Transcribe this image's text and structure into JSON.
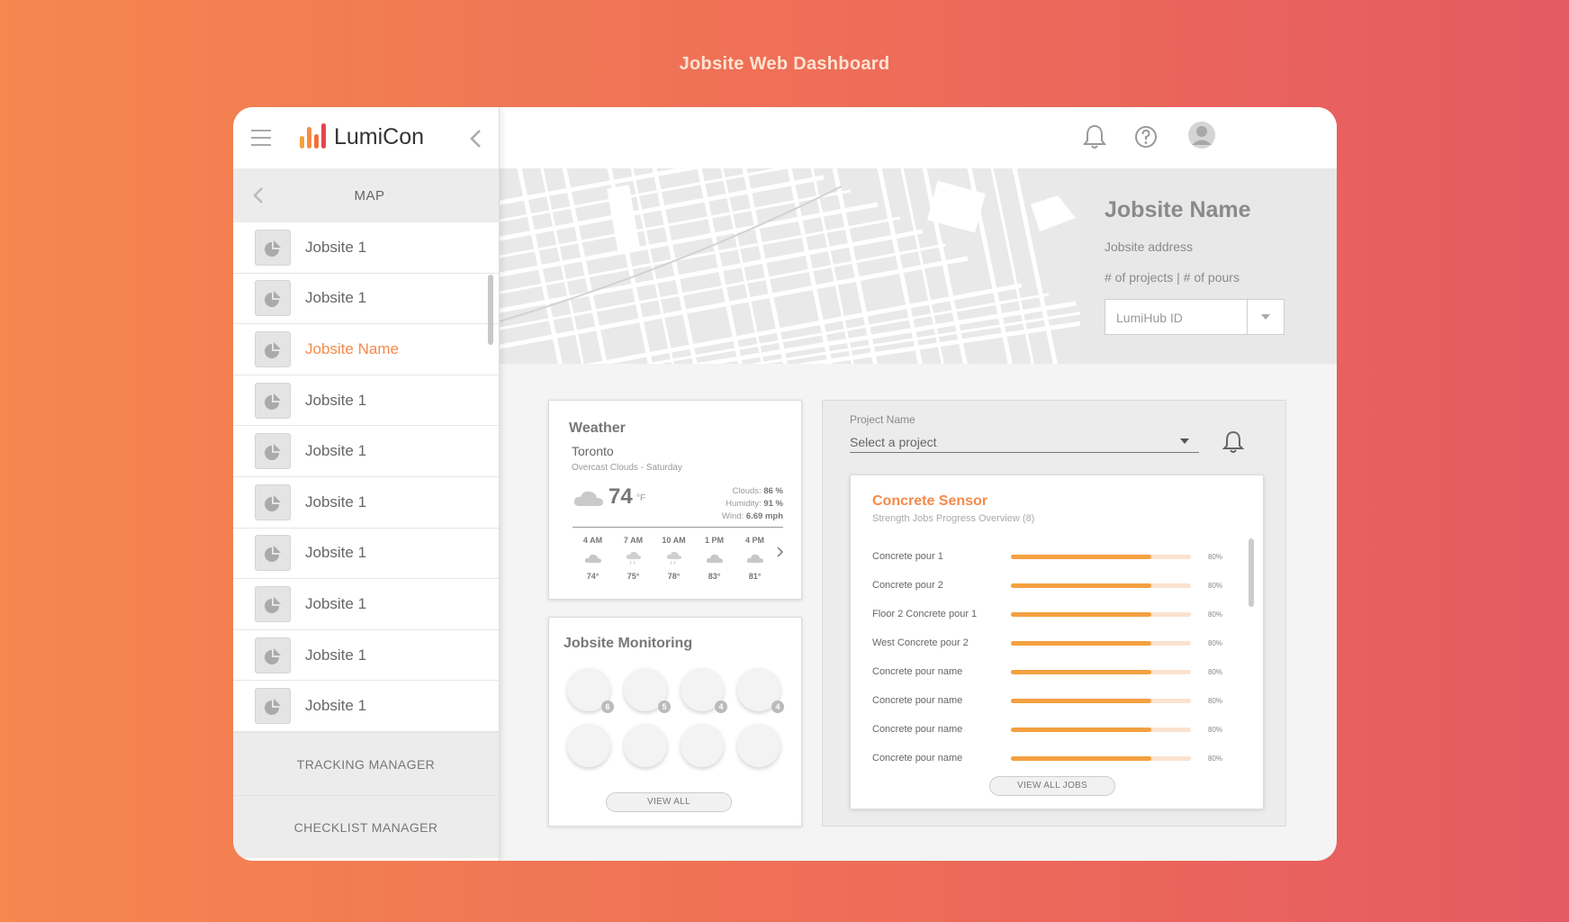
{
  "page_heading": "Jobsite Web Dashboard",
  "brand": {
    "name": "LumiCon",
    "colors": {
      "accent": "#f58a4a",
      "bar_fill": "#f4a040",
      "bar_track": "#fbe2cf"
    }
  },
  "sidebar": {
    "map_label": "MAP",
    "items": [
      {
        "label": "Jobsite 1",
        "active": false
      },
      {
        "label": "Jobsite 1",
        "active": false
      },
      {
        "label": "Jobsite Name",
        "active": true
      },
      {
        "label": "Jobsite 1",
        "active": false
      },
      {
        "label": "Jobsite 1",
        "active": false
      },
      {
        "label": "Jobsite 1",
        "active": false
      },
      {
        "label": "Jobsite 1",
        "active": false
      },
      {
        "label": "Jobsite 1",
        "active": false
      },
      {
        "label": "Jobsite 1",
        "active": false
      },
      {
        "label": "Jobsite 1",
        "active": false
      }
    ],
    "tracking_manager": "TRACKING MANAGER",
    "checklist_manager": "CHECKLIST MANAGER"
  },
  "header": {
    "icons": [
      "bell-icon",
      "help-icon",
      "avatar",
      "chevron-down-icon"
    ]
  },
  "jobsite": {
    "title": "Jobsite Name",
    "address": "Jobsite address",
    "counts": "# of projects | # of pours",
    "hub_select": "LumiHub ID"
  },
  "weather": {
    "title": "Weather",
    "city": "Toronto",
    "description": "Overcast Clouds - Saturday",
    "temp": "74",
    "unit": "°F",
    "clouds_label": "Clouds:",
    "clouds": "86 %",
    "humidity_label": "Humidity:",
    "humidity": "91 %",
    "wind_label": "Wind:",
    "wind": "6.69 mph",
    "hours": [
      {
        "time": "4 AM",
        "temp": "74°",
        "icon": "cloud-icon"
      },
      {
        "time": "7 AM",
        "temp": "75°",
        "icon": "rain-icon"
      },
      {
        "time": "10 AM",
        "temp": "78°",
        "icon": "rain-icon"
      },
      {
        "time": "1 PM",
        "temp": "83°",
        "icon": "cloud-icon"
      },
      {
        "time": "4 PM",
        "temp": "81°",
        "icon": "cloud-icon"
      }
    ]
  },
  "monitoring": {
    "title": "Jobsite Monitoring",
    "gauges": [
      {
        "count": "6"
      },
      {
        "count": "5"
      },
      {
        "count": "4"
      },
      {
        "count": "4"
      },
      {
        "count": null
      },
      {
        "count": null
      },
      {
        "count": null
      },
      {
        "count": null
      }
    ],
    "view_all": "VIEW ALL"
  },
  "project": {
    "label": "Project Name",
    "placeholder": "Select a project"
  },
  "sensor": {
    "title": "Concrete Sensor",
    "subtitle": "Strength Jobs Progress Overview (8)",
    "jobs": [
      {
        "name": "Concrete pour 1",
        "pct_label": "80%",
        "progress": 0.78
      },
      {
        "name": "Concrete pour 2",
        "pct_label": "80%",
        "progress": 0.78
      },
      {
        "name": "Floor 2 Concrete pour 1",
        "pct_label": "80%",
        "progress": 0.78
      },
      {
        "name": "West Concrete pour 2",
        "pct_label": "80%",
        "progress": 0.78
      },
      {
        "name": "Concrete pour name",
        "pct_label": "80%",
        "progress": 0.78
      },
      {
        "name": "Concrete pour name",
        "pct_label": "80%",
        "progress": 0.78
      },
      {
        "name": "Concrete pour name",
        "pct_label": "80%",
        "progress": 0.78
      },
      {
        "name": "Concrete pour name",
        "pct_label": "80%",
        "progress": 0.78
      }
    ],
    "view_all": "VIEW ALL JOBS"
  }
}
